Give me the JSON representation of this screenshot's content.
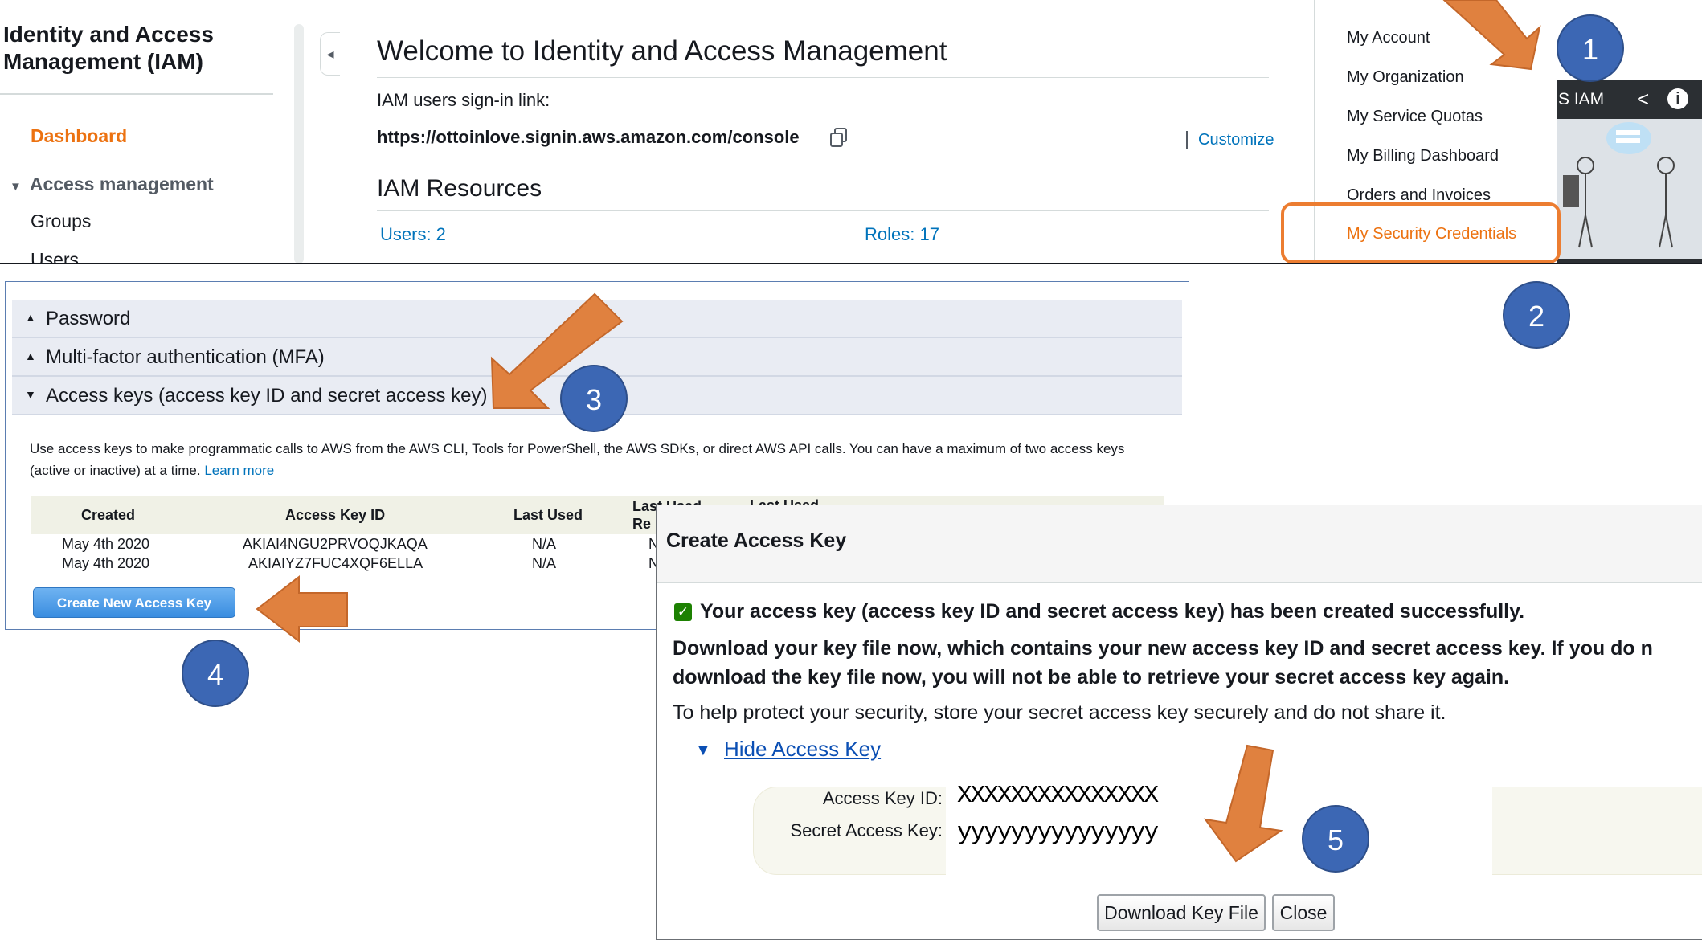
{
  "sidebar": {
    "title_line1": "Identity and Access",
    "title_line2": "Management (IAM)",
    "dashboard": "Dashboard",
    "access_management": "Access management",
    "groups": "Groups",
    "users": "Users"
  },
  "main": {
    "welcome": "Welcome to Identity and Access Management",
    "signin_label": "IAM users sign-in link:",
    "signin_url": "https://ottoinlove.signin.aws.amazon.com/console",
    "customize": "Customize",
    "resources_title": "IAM Resources",
    "users_link": "Users: 2",
    "roles_link": "Roles: 17"
  },
  "account_menu": {
    "items": [
      "My Account",
      "My Organization",
      "My Service Quotas",
      "My Billing Dashboard",
      "Orders and Invoices",
      "My Security Credentials"
    ]
  },
  "video": {
    "title": "S IAM"
  },
  "credentials": {
    "sections": [
      {
        "label": "Password",
        "expanded": false
      },
      {
        "label": "Multi-factor authentication (MFA)",
        "expanded": false
      },
      {
        "label": "Access keys (access key ID and secret access key)",
        "expanded": true
      }
    ],
    "description": "Use access keys to make programmatic calls to AWS from the AWS CLI, Tools for PowerShell, the AWS SDKs, or direct AWS API calls. You can have a maximum of two access keys (active or inactive) at a time.",
    "learn_more": "Learn more",
    "columns": [
      "Created",
      "Access Key ID",
      "Last Used",
      "Last Used Re",
      "Last Used"
    ],
    "rows": [
      {
        "created": "May 4th 2020",
        "key_id": "AKIAI4NGU2PRVOQJKAQA",
        "last_used": "N/A",
        "extra": "N"
      },
      {
        "created": "May 4th 2020",
        "key_id": "AKIAIYZ7FUC4XQF6ELLA",
        "last_used": "N/A",
        "extra": "N"
      }
    ],
    "create_button": "Create New Access Key"
  },
  "dialog": {
    "title": "Create Access Key",
    "success": "Your access key (access key ID and secret access key) has been created successfully.",
    "warning_line1": "Download your key file now, which contains your new access key ID and secret access key. If you do n",
    "warning_line2": "download the key file now, you will not be able to retrieve your secret access key again.",
    "protect": "To help protect your security, store your secret access key securely and do not share it.",
    "hide_link": "Hide Access Key",
    "access_key_label": "Access Key ID:",
    "access_key_value": "XXXXXXXXXXXXXXX",
    "secret_label": "Secret Access Key:",
    "secret_value": "yyyyyyyyyyyyyyy",
    "download_button": "Download Key File",
    "close_button": "Close"
  },
  "callouts": [
    "1",
    "2",
    "3",
    "4",
    "5"
  ],
  "colors": {
    "accent_orange": "#ec7211",
    "arrow_orange": "#e0813f",
    "link_blue": "#0073bb",
    "callout_blue": "#3c67b4",
    "success_green": "#1d8102"
  },
  "icons": [
    "chevron-left-icon",
    "copy-icon",
    "caret-down-icon",
    "caret-up-icon",
    "share-icon",
    "info-icon",
    "checkbox-checked-icon",
    "arrow-icon"
  ]
}
